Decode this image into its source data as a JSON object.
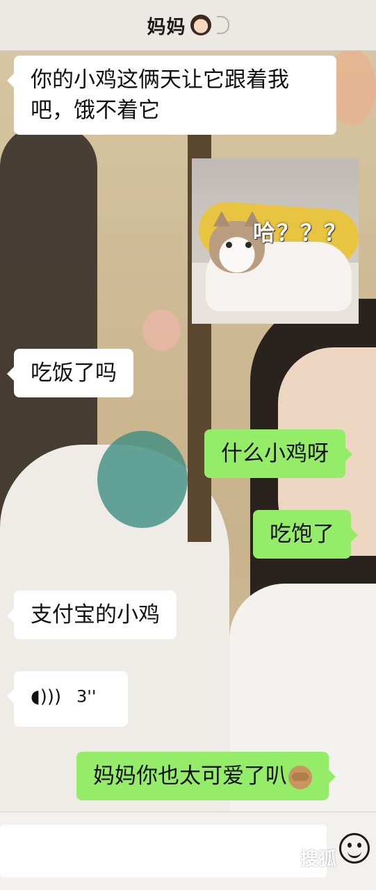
{
  "header": {
    "title": "妈妈",
    "avatar_emoji_icon": "woman-face-icon",
    "earpiece_icon": "ear-icon"
  },
  "messages": [
    {
      "side": "left",
      "type": "text",
      "text": "你的小鸡这俩天让它跟着我吧，饿不着它"
    },
    {
      "side": "right",
      "type": "image",
      "image_caption": "哈？？？",
      "image_icon": "cat-meme-image"
    },
    {
      "side": "left",
      "type": "text",
      "text": "吃饭了吗"
    },
    {
      "side": "right",
      "type": "text",
      "text": "什么小鸡呀"
    },
    {
      "side": "right",
      "type": "text",
      "text": "吃饱了"
    },
    {
      "side": "left",
      "type": "text",
      "text": "支付宝的小鸡"
    },
    {
      "side": "left",
      "type": "voice",
      "duration": "3''",
      "icon": "voice-wave-icon"
    },
    {
      "side": "right",
      "type": "text",
      "text": "妈妈你也太可爱了叭",
      "emoji_icon": "see-no-evil-monkey-icon"
    }
  ],
  "input": {
    "placeholder": "",
    "emoji_button_icon": "smiley-icon"
  },
  "watermark": "搜狐"
}
